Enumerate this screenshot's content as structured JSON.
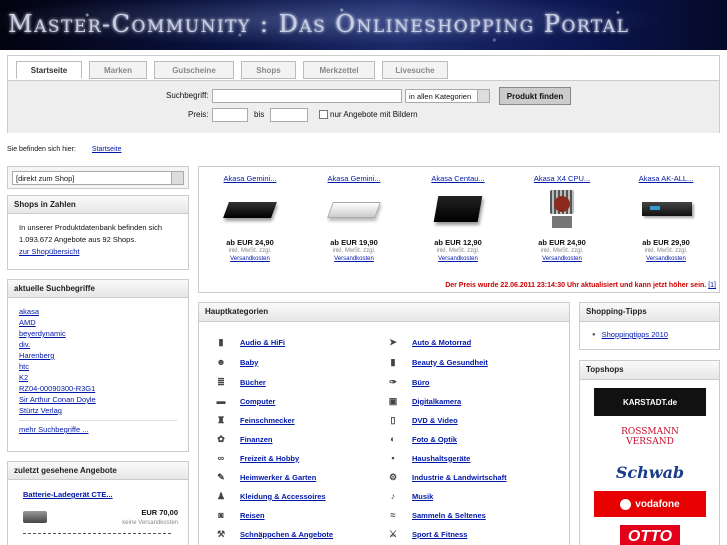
{
  "banner": {
    "title": "Master-Community : Das Onlineshopping Portal"
  },
  "tabs": [
    "Startseite",
    "Marken",
    "Gutscheine",
    "Shops",
    "Merkzettel",
    "Livesuche"
  ],
  "search": {
    "term_label": "Suchbegriff:",
    "category_value": "in allen Kategorien",
    "submit_label": "Produkt finden",
    "price_label": "Preis:",
    "to_label": "bis",
    "images_only_label": "nur Angebote mit Bildern"
  },
  "breadcrumb": {
    "label": "Sie befinden sich hier:",
    "link": "Startseite"
  },
  "shop_select": {
    "value": "[direkt zum Shop]"
  },
  "shops_in_numbers": {
    "title": "Shops in Zahlen",
    "text": "In unserer Produktdatenbank befinden sich 1.093.672 Angebote aus 92 Shops.",
    "link": "zur Shopübersicht"
  },
  "recent_searches": {
    "title": "aktuelle Suchbegriffe",
    "items": [
      "akasa",
      "AMD",
      "beyerdynamic",
      "div.",
      "Harenberg",
      "htc",
      "K2",
      "RZ04-00090300-R3G1",
      "Sir Arthur Conan Doyle",
      "Stürtz Verlag"
    ],
    "more": "mehr Suchbegriffe ..."
  },
  "recent_viewed": {
    "title": "zuletzt gesehene Angebote",
    "item_name": "Batterie-Ladegerät CTE...",
    "item_price": "EUR 70,00",
    "item_shipping": "keine Versandkosten"
  },
  "products": [
    {
      "name": "Akasa Gemini...",
      "price": "ab EUR 24,90",
      "tax": "inkl. MwSt. zzgl.",
      "ship": "Versandkosten",
      "icon": "black-case"
    },
    {
      "name": "Akasa Gemini...",
      "price": "ab EUR 19,90",
      "tax": "inkl. MwSt. zzgl.",
      "ship": "Versandkosten",
      "icon": "white-case"
    },
    {
      "name": "Akasa Centau...",
      "price": "ab EUR 12,90",
      "tax": "inkl. MwSt. zzgl.",
      "ship": "Versandkosten",
      "icon": "black-pad"
    },
    {
      "name": "Akasa X4 CPU...",
      "price": "ab EUR 24,90",
      "tax": "inkl. MwSt. zzgl.",
      "ship": "Versandkosten",
      "icon": "cpu-cooler"
    },
    {
      "name": "Akasa AK-ALL...",
      "price": "ab EUR 29,90",
      "tax": "inkl. MwSt. zzgl.",
      "ship": "Versandkosten",
      "icon": "drive-bay"
    }
  ],
  "price_note": {
    "text": "Der Preis wurde 22.06.2011 23:14:30 Uhr aktualisiert und kann jetzt höher sein.",
    "ref": "[1]"
  },
  "main_categories": {
    "title": "Hauptkategorien",
    "left": [
      "Audio & HiFi",
      "Baby",
      "Bücher",
      "Computer",
      "Feinschmecker",
      "Finanzen",
      "Freizeit & Hobby",
      "Heimwerker & Garten",
      "Kleidung & Accessoires",
      "Reisen",
      "Schnäppchen & Angebote"
    ],
    "right": [
      "Auto & Motorrad",
      "Beauty & Gesundheit",
      "Büro",
      "Digitalkamera",
      "DVD & Video",
      "Foto & Optik",
      "Haushaltsgeräte",
      "Industrie & Landwirtschaft",
      "Musik",
      "Sammeln & Seltenes",
      "Sport & Fitness"
    ]
  },
  "shopping_tips": {
    "title": "Shopping-Tipps",
    "item": "Shoppingtipps 2010"
  },
  "top_shops": {
    "title": "Topshops",
    "shops": [
      {
        "name": "KARSTADT.de",
        "color": "#1a1a1a"
      },
      {
        "name": "ROSSMANN VERSAND",
        "color": "#c8102e"
      },
      {
        "name": "Schwab",
        "color": "#1a3c8c"
      },
      {
        "name": "vodafone",
        "color": "#e60000"
      },
      {
        "name": "OTTO",
        "color": "#e2001a"
      }
    ]
  }
}
